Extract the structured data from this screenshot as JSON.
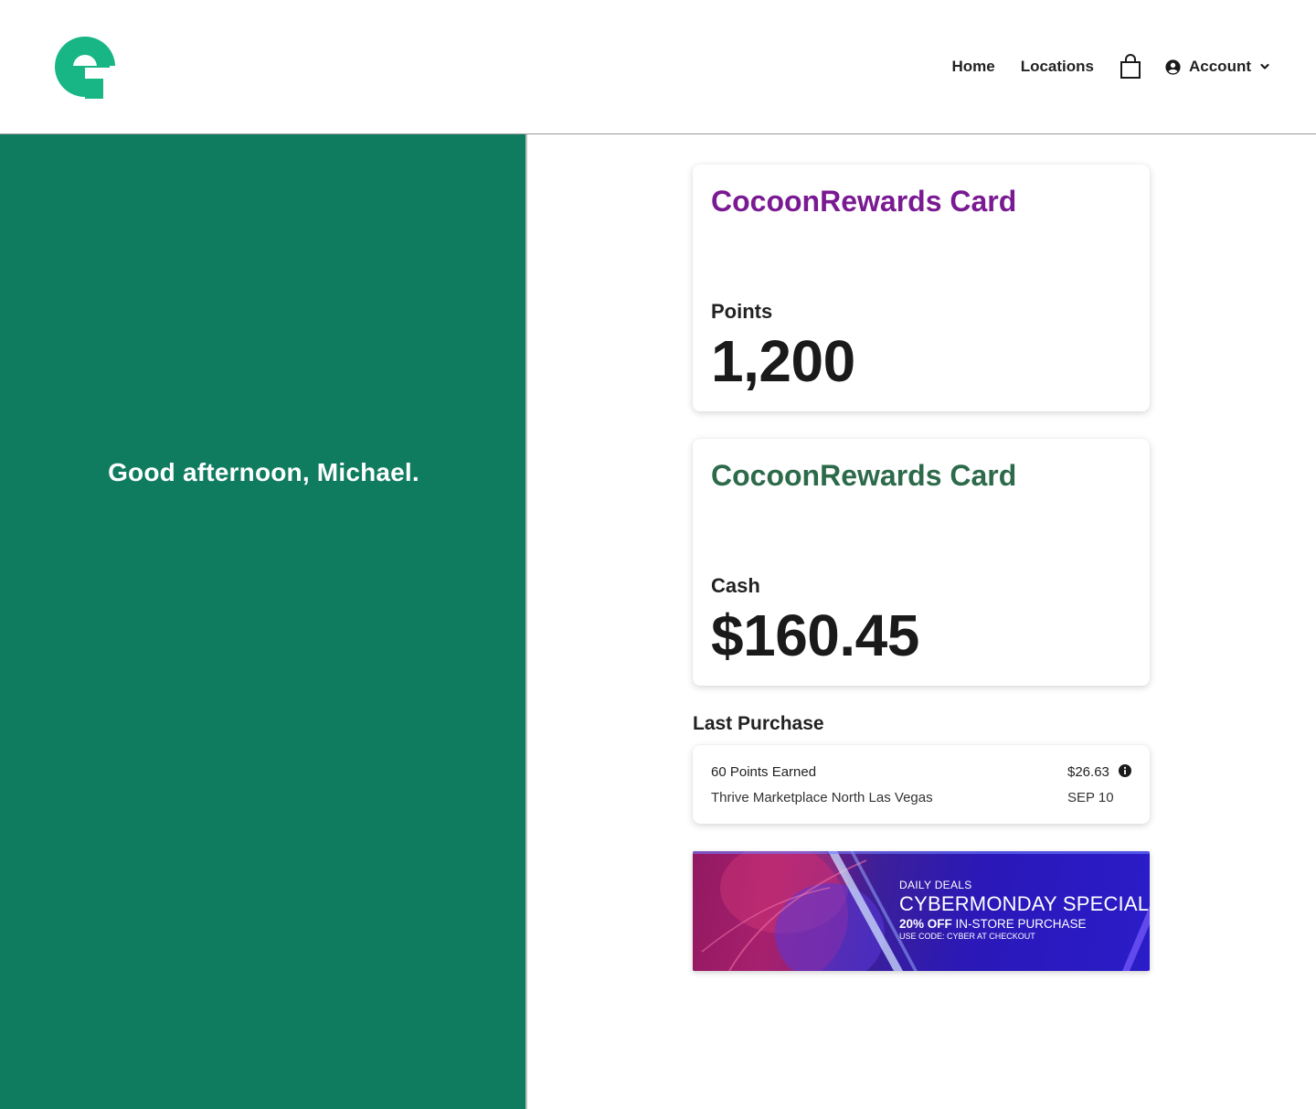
{
  "header": {
    "logo_icon": "brand-logo-icon",
    "brand_color": "#18b685",
    "nav": {
      "home": "Home",
      "locations": "Locations",
      "cart_icon": "shopping-bag-icon",
      "account": "Account",
      "account_icon": "user-circle-icon",
      "account_chevron": "chevron-down-icon"
    }
  },
  "left_panel": {
    "greeting": "Good afternoon, Michael.",
    "background": "#0f7b5f"
  },
  "points_card": {
    "title": "CocoonRewards Card",
    "title_color": "#7a1a92",
    "label": "Points",
    "value": "1,200"
  },
  "cash_card": {
    "title": "CocoonRewards Card",
    "title_color": "#2c6a4a",
    "label": "Cash",
    "value": "$160.45"
  },
  "last_purchase": {
    "section_title": "Last Purchase",
    "points_earned": "60 Points Earned",
    "store": "Thrive Marketplace North Las Vegas",
    "amount": "$26.63",
    "date": "SEP 10",
    "info_icon": "info-icon"
  },
  "promo_banner": {
    "eyebrow": "DAILY DEALS",
    "headline": "CYBERMONDAY SPECIAL",
    "offer_bold": "20% OFF",
    "offer_rest": " IN-STORE PURCHASE",
    "code_text": "USE CODE: CYBER AT CHECKOUT"
  }
}
